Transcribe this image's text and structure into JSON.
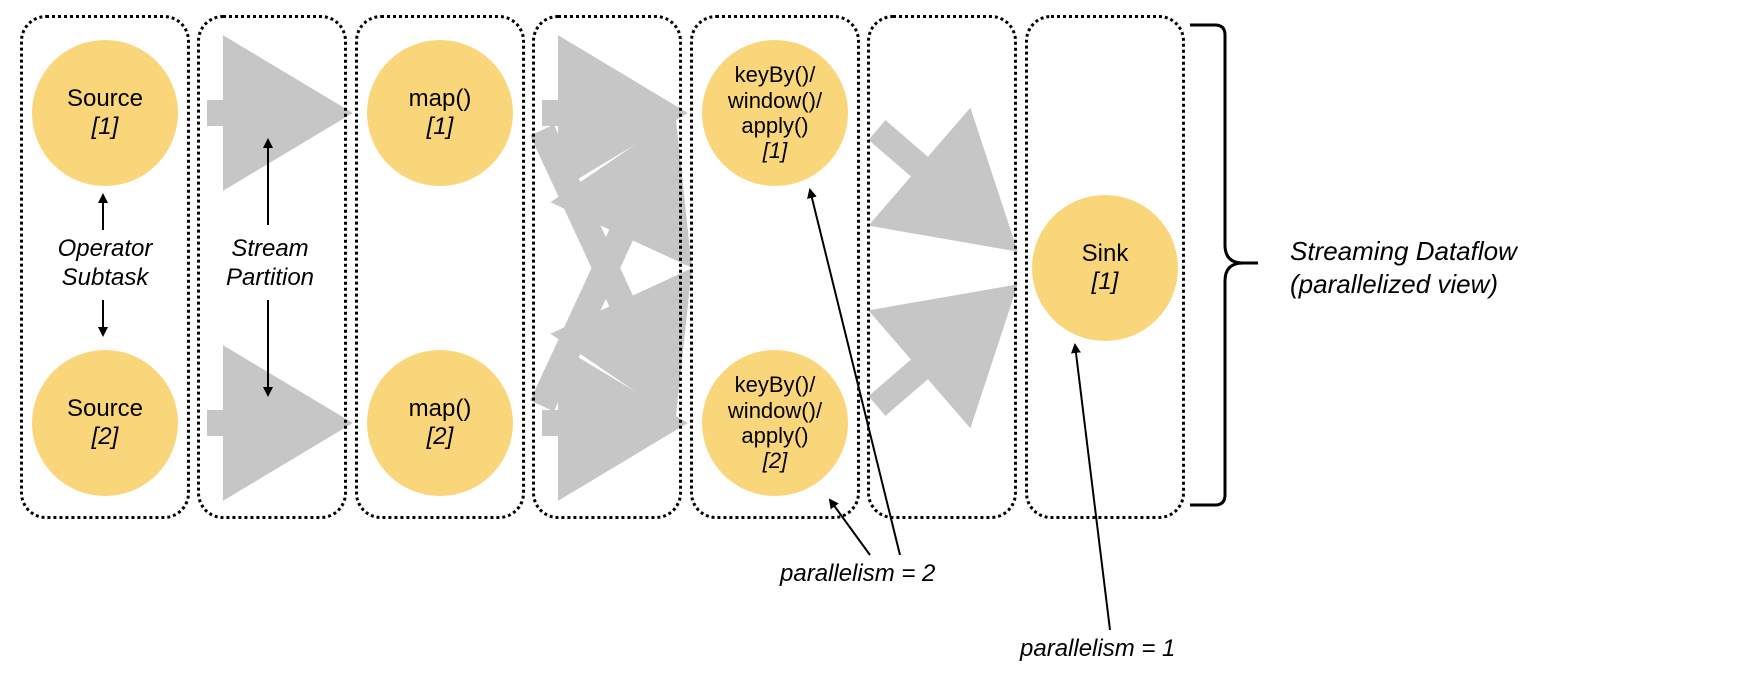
{
  "nodes": {
    "source1": {
      "name": "Source",
      "index": "[1]"
    },
    "source2": {
      "name": "Source",
      "index": "[2]"
    },
    "map1": {
      "name": "map()",
      "index": "[1]"
    },
    "map2": {
      "name": "map()",
      "index": "[2]"
    },
    "kw1": {
      "line1": "keyBy()/",
      "line2": "window()/",
      "line3": "apply()",
      "index": "[1]"
    },
    "kw2": {
      "line1": "keyBy()/",
      "line2": "window()/",
      "line3": "apply()",
      "index": "[2]"
    },
    "sink1": {
      "name": "Sink",
      "index": "[1]"
    }
  },
  "labels": {
    "operatorSubtask": {
      "l1": "Operator",
      "l2": "Subtask"
    },
    "streamPartition": {
      "l1": "Stream",
      "l2": "Partition"
    },
    "parallelism2": "parallelism = 2",
    "parallelism1": "parallelism = 1",
    "rightTitle": {
      "l1": "Streaming Dataflow",
      "l2": "(parallelized view)"
    }
  }
}
